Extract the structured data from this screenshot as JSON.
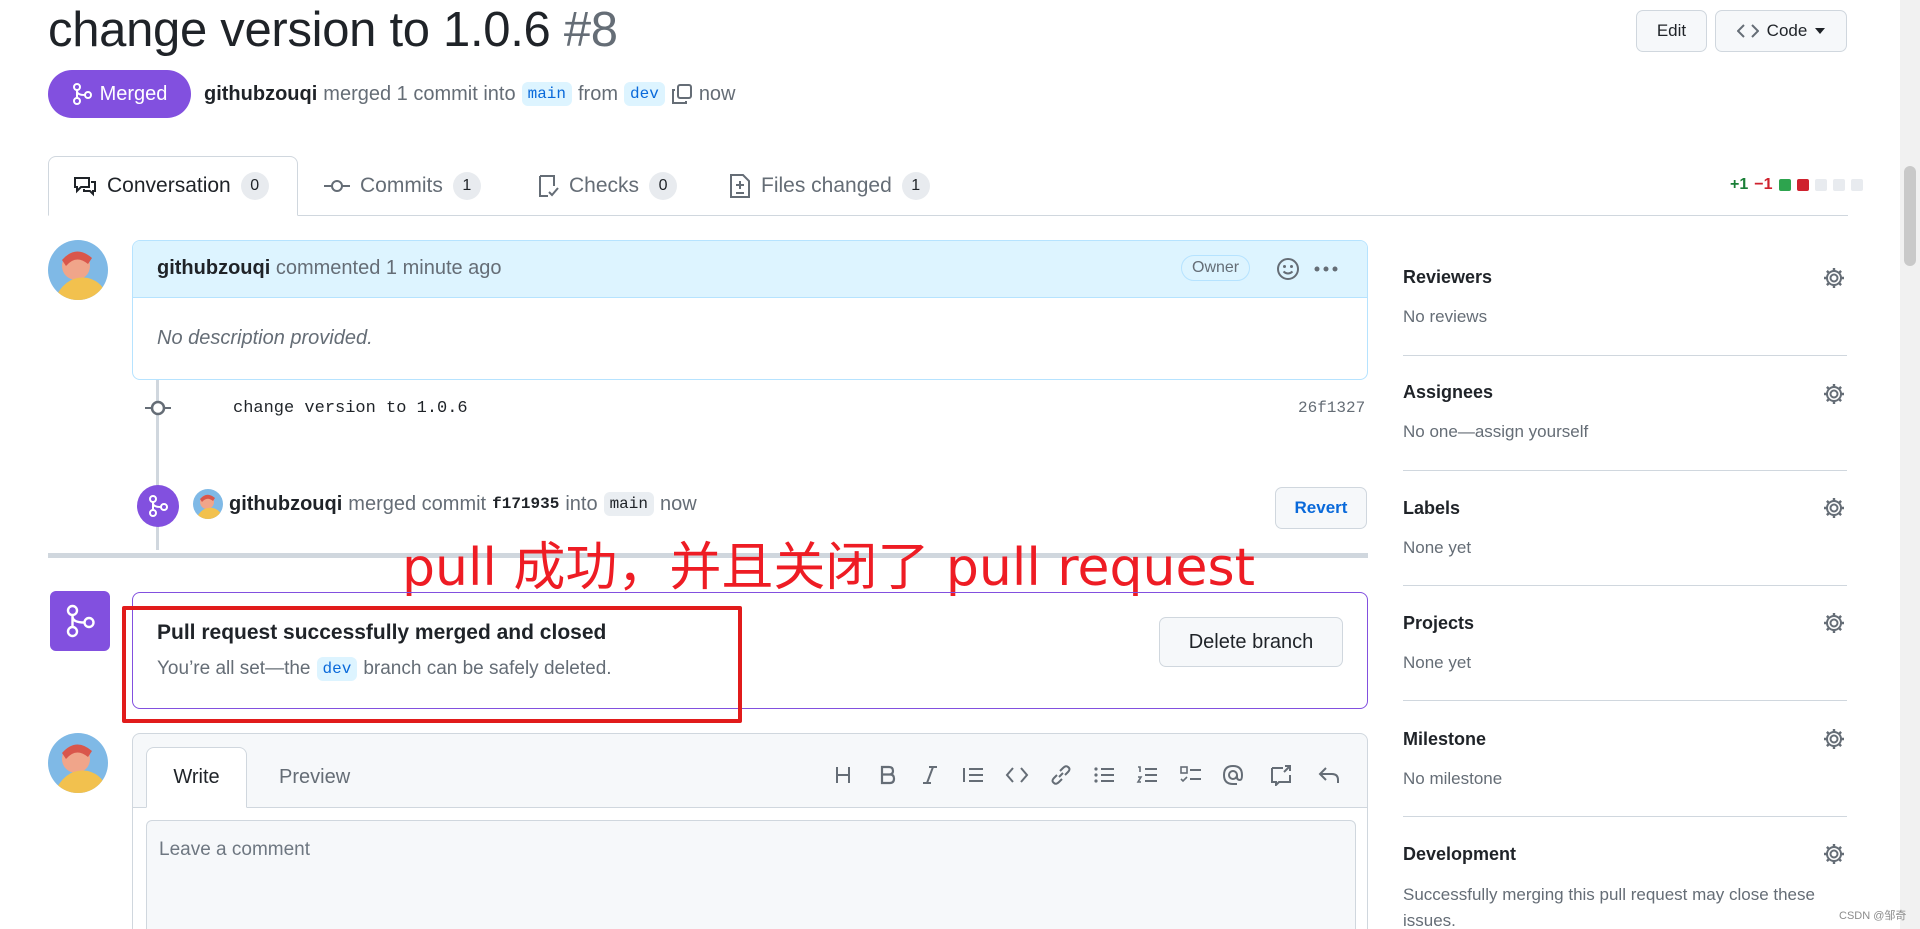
{
  "pr": {
    "title": "change version to 1.0.6",
    "number": "#8",
    "status": "Merged",
    "author": "githubzouqi",
    "merged_text": "merged 1 commit into",
    "base_branch": "main",
    "from_text": "from",
    "head_branch": "dev",
    "time": "now"
  },
  "header_buttons": {
    "edit": "Edit",
    "code": "Code"
  },
  "tabs": [
    {
      "label": "Conversation",
      "count": "0"
    },
    {
      "label": "Commits",
      "count": "1"
    },
    {
      "label": "Checks",
      "count": "0"
    },
    {
      "label": "Files changed",
      "count": "1"
    }
  ],
  "diffstat": {
    "additions": "+1",
    "deletions": "−1"
  },
  "comment": {
    "author": "githubzouqi",
    "action": "commented 1 minute ago",
    "role": "Owner",
    "body": "No description provided."
  },
  "commit": {
    "message": "change version to 1.0.6",
    "sha": "26f1327"
  },
  "merge_event": {
    "author": "githubzouqi",
    "action": "merged commit",
    "sha": "f171935",
    "into": "into",
    "branch": "main",
    "time": "now",
    "revert": "Revert"
  },
  "annotation": "pull 成功，并且关闭了 pull request",
  "merged_box": {
    "title": "Pull request successfully merged and closed",
    "desc_before": "You’re all set—the",
    "branch": "dev",
    "desc_after": "branch can be safely deleted.",
    "delete_button": "Delete branch"
  },
  "editor": {
    "write_tab": "Write",
    "preview_tab": "Preview",
    "placeholder": "Leave a comment"
  },
  "sidebar": [
    {
      "title": "Reviewers",
      "value": "No reviews"
    },
    {
      "title": "Assignees",
      "value": "No one—assign yourself"
    },
    {
      "title": "Labels",
      "value": "None yet"
    },
    {
      "title": "Projects",
      "value": "None yet"
    },
    {
      "title": "Milestone",
      "value": "No milestone"
    },
    {
      "title": "Development",
      "value": "Successfully merging this pull request may close these issues."
    }
  ],
  "watermark": "CSDN @邹奇",
  "colors": {
    "merged": "#8250df",
    "link": "#0969da",
    "annotation": "#ee1c24",
    "add": "#1a7f37",
    "del": "#cf222e"
  }
}
